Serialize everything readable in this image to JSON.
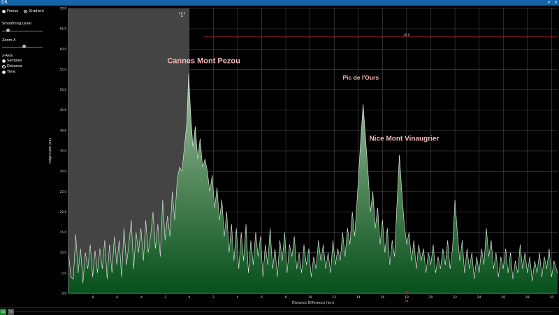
{
  "window": {
    "title": "DR",
    "restore_glyph": "⇗",
    "close_glyph": "×"
  },
  "sidebar": {
    "freeze_label": "Freeze",
    "gradient_label": "Gradient",
    "smoothing_label": "Smoothing Level",
    "smoothing_value": 0.12,
    "zoom_label": "Zoom X",
    "zoom_value": 0.55,
    "xaxis_label": "x-Axis",
    "xaxis_options": [
      "Samples",
      "Distance",
      "Time"
    ],
    "xaxis_selected": "Distance"
  },
  "status": {
    "ok_label": "OK",
    "other_label": "TX"
  },
  "chart_data": {
    "type": "area",
    "xlabel": "Distance Difference (km)",
    "ylabel": "Magnitude (dB)",
    "xlim": [
      -10,
      30.5
    ],
    "ylim": [
      0,
      70
    ],
    "xticks": [
      -8,
      -6,
      -4,
      -2,
      0,
      2,
      4,
      6,
      8,
      10,
      12,
      14,
      16,
      18,
      20,
      22,
      24,
      26,
      28,
      30
    ],
    "yticks": [
      0,
      5,
      10,
      15,
      20,
      25,
      30,
      35,
      40,
      45,
      50,
      55,
      60,
      65,
      70
    ],
    "ytick_labels": [
      "0.0",
      "5.0",
      "10.0",
      "15.0",
      "20.0",
      "25.0",
      "30.0",
      "35.0",
      "40.0",
      "45.0",
      "50.0",
      "55.0",
      "60.0",
      "65.0",
      "70.0"
    ],
    "grid": true,
    "shaded_region": [
      -10,
      0
    ],
    "threshold": {
      "value": 63,
      "x_start": 1.2,
      "label": "28.0"
    },
    "peak_marker": {
      "x": -0.6,
      "y": 68.5,
      "label": "28.6"
    },
    "bottom_marker": {
      "x": 18,
      "label": "18"
    },
    "annotations": [
      {
        "text": "Cannes Mont Pezou",
        "x": 1.2,
        "y": 56.5
      },
      {
        "text": "Pic de l'Ours",
        "x": 14.2,
        "y": 52.5
      },
      {
        "text": "Nice Mont Vinaugrier",
        "x": 17.8,
        "y": 37.5
      }
    ],
    "points": [
      [
        -10,
        10
      ],
      [
        -9.8,
        4
      ],
      [
        -9.6,
        3.5
      ],
      [
        -9.4,
        14.5
      ],
      [
        -9.2,
        5
      ],
      [
        -9,
        11
      ],
      [
        -8.8,
        2.5
      ],
      [
        -8.6,
        10
      ],
      [
        -8.4,
        6
      ],
      [
        -8.2,
        12
      ],
      [
        -8,
        4
      ],
      [
        -7.8,
        10.5
      ],
      [
        -7.6,
        5
      ],
      [
        -7.4,
        11
      ],
      [
        -7.2,
        6
      ],
      [
        -7,
        13
      ],
      [
        -6.8,
        3.5
      ],
      [
        -6.6,
        12
      ],
      [
        -6.4,
        5
      ],
      [
        -6.2,
        14
      ],
      [
        -6,
        7
      ],
      [
        -5.8,
        13
      ],
      [
        -5.6,
        4
      ],
      [
        -5.4,
        16
      ],
      [
        -5.2,
        7
      ],
      [
        -5,
        12
      ],
      [
        -4.8,
        18
      ],
      [
        -4.6,
        6
      ],
      [
        -4.4,
        15
      ],
      [
        -4.2,
        10
      ],
      [
        -4,
        16
      ],
      [
        -3.8,
        8
      ],
      [
        -3.6,
        18
      ],
      [
        -3.4,
        10
      ],
      [
        -3.2,
        14
      ],
      [
        -3,
        20
      ],
      [
        -2.8,
        11
      ],
      [
        -2.6,
        17
      ],
      [
        -2.4,
        9
      ],
      [
        -2.2,
        23
      ],
      [
        -2,
        13
      ],
      [
        -1.8,
        19
      ],
      [
        -1.6,
        14
      ],
      [
        -1.4,
        25
      ],
      [
        -1.2,
        18
      ],
      [
        -1,
        28
      ],
      [
        -0.8,
        31
      ],
      [
        -0.6,
        30
      ],
      [
        -0.4,
        36
      ],
      [
        -0.2,
        42
      ],
      [
        -0.05,
        54
      ],
      [
        0.1,
        45
      ],
      [
        0.3,
        36
      ],
      [
        0.5,
        41
      ],
      [
        0.7,
        33
      ],
      [
        0.9,
        38
      ],
      [
        1.1,
        31
      ],
      [
        1.3,
        33
      ],
      [
        1.5,
        30
      ],
      [
        1.7,
        25
      ],
      [
        1.9,
        29
      ],
      [
        2.1,
        21
      ],
      [
        2.3,
        26
      ],
      [
        2.5,
        18
      ],
      [
        2.7,
        23
      ],
      [
        2.9,
        14
      ],
      [
        3.1,
        20
      ],
      [
        3.3,
        10
      ],
      [
        3.5,
        17
      ],
      [
        3.7,
        8
      ],
      [
        3.9,
        16
      ],
      [
        4.1,
        6
      ],
      [
        4.3,
        15
      ],
      [
        4.5,
        8
      ],
      [
        4.7,
        17
      ],
      [
        4.9,
        5
      ],
      [
        5.1,
        13
      ],
      [
        5.3,
        7
      ],
      [
        5.5,
        15
      ],
      [
        5.7,
        9
      ],
      [
        5.9,
        14
      ],
      [
        6.1,
        4
      ],
      [
        6.3,
        12
      ],
      [
        6.5,
        7
      ],
      [
        6.7,
        16
      ],
      [
        6.9,
        6
      ],
      [
        7.1,
        11
      ],
      [
        7.3,
        4
      ],
      [
        7.5,
        13
      ],
      [
        7.7,
        8
      ],
      [
        7.9,
        15
      ],
      [
        8.1,
        5
      ],
      [
        8.3,
        12
      ],
      [
        8.5,
        9
      ],
      [
        8.7,
        14
      ],
      [
        8.9,
        6
      ],
      [
        9.1,
        10
      ],
      [
        9.3,
        5
      ],
      [
        9.5,
        12
      ],
      [
        9.7,
        7
      ],
      [
        9.9,
        11
      ],
      [
        10.1,
        4
      ],
      [
        10.3,
        9
      ],
      [
        10.5,
        6
      ],
      [
        10.7,
        13
      ],
      [
        10.9,
        8
      ],
      [
        11.1,
        12
      ],
      [
        11.3,
        6
      ],
      [
        11.5,
        10
      ],
      [
        11.7,
        5
      ],
      [
        11.9,
        13
      ],
      [
        12.1,
        7
      ],
      [
        12.3,
        11
      ],
      [
        12.5,
        8
      ],
      [
        12.7,
        15
      ],
      [
        12.9,
        9
      ],
      [
        13.1,
        16
      ],
      [
        13.3,
        12
      ],
      [
        13.5,
        20
      ],
      [
        13.7,
        14
      ],
      [
        13.9,
        23
      ],
      [
        14.0,
        28
      ],
      [
        14.2,
        38
      ],
      [
        14.4,
        46.5
      ],
      [
        14.6,
        38
      ],
      [
        14.8,
        30
      ],
      [
        15.0,
        20
      ],
      [
        15.2,
        25
      ],
      [
        15.4,
        16
      ],
      [
        15.6,
        21
      ],
      [
        15.8,
        12
      ],
      [
        16.0,
        18
      ],
      [
        16.2,
        10
      ],
      [
        16.4,
        16
      ],
      [
        16.6,
        7
      ],
      [
        16.8,
        13
      ],
      [
        17.0,
        9
      ],
      [
        17.2,
        22
      ],
      [
        17.4,
        34
      ],
      [
        17.6,
        25
      ],
      [
        17.8,
        17
      ],
      [
        18.0,
        12
      ],
      [
        18.2,
        15
      ],
      [
        18.4,
        8
      ],
      [
        18.6,
        13
      ],
      [
        18.8,
        6
      ],
      [
        19.0,
        12
      ],
      [
        19.2,
        8
      ],
      [
        19.4,
        11
      ],
      [
        19.6,
        5
      ],
      [
        19.8,
        10
      ],
      [
        20.0,
        7
      ],
      [
        20.2,
        12
      ],
      [
        20.4,
        5
      ],
      [
        20.6,
        9
      ],
      [
        20.8,
        6
      ],
      [
        21.0,
        11
      ],
      [
        21.2,
        7
      ],
      [
        21.4,
        13
      ],
      [
        21.6,
        6
      ],
      [
        21.8,
        11
      ],
      [
        22.0,
        23
      ],
      [
        22.2,
        15
      ],
      [
        22.4,
        8
      ],
      [
        22.6,
        13
      ],
      [
        22.8,
        5
      ],
      [
        23.0,
        11
      ],
      [
        23.2,
        6
      ],
      [
        23.4,
        10
      ],
      [
        23.6,
        3.5
      ],
      [
        23.8,
        9
      ],
      [
        24.0,
        5
      ],
      [
        24.2,
        11
      ],
      [
        24.4,
        7
      ],
      [
        24.6,
        16
      ],
      [
        24.8,
        9
      ],
      [
        25.0,
        13
      ],
      [
        25.2,
        6
      ],
      [
        25.4,
        10
      ],
      [
        25.6,
        4
      ],
      [
        25.8,
        9
      ],
      [
        26.0,
        6
      ],
      [
        26.2,
        11
      ],
      [
        26.4,
        5
      ],
      [
        26.6,
        10
      ],
      [
        26.8,
        3.5
      ],
      [
        27.0,
        8
      ],
      [
        27.2,
        5
      ],
      [
        27.4,
        12
      ],
      [
        27.6,
        6
      ],
      [
        27.8,
        10
      ],
      [
        28.0,
        5
      ],
      [
        28.2,
        9
      ],
      [
        28.4,
        3
      ],
      [
        28.6,
        8
      ],
      [
        28.8,
        5
      ],
      [
        29.0,
        10
      ],
      [
        29.2,
        4
      ],
      [
        29.4,
        9
      ],
      [
        29.6,
        6
      ],
      [
        29.8,
        11
      ],
      [
        30.0,
        4
      ],
      [
        30.2,
        8
      ],
      [
        30.5,
        5
      ]
    ]
  }
}
